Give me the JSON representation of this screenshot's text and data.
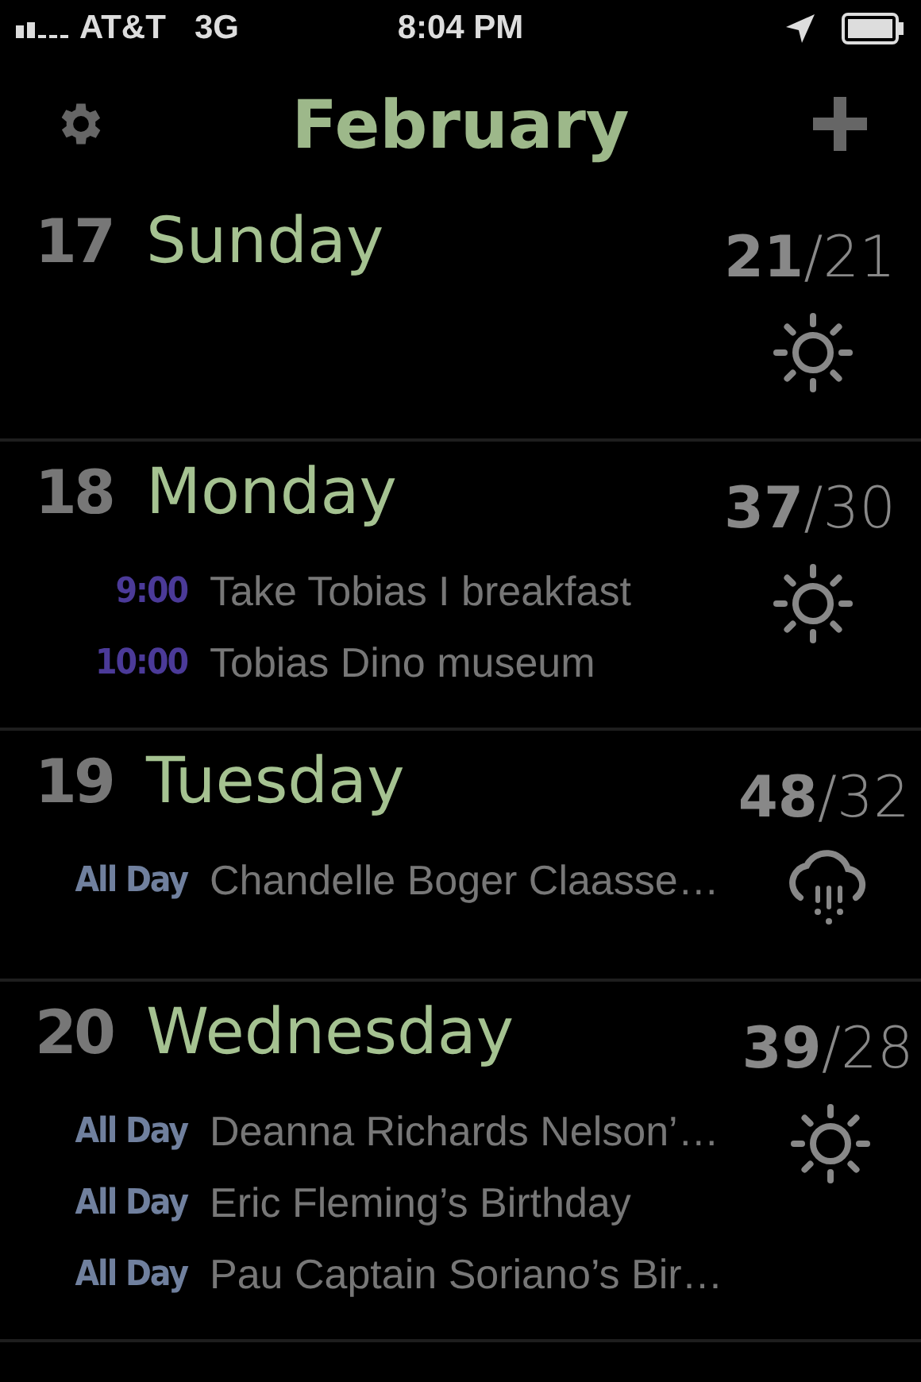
{
  "status_bar": {
    "carrier": "AT&T",
    "network": "3G",
    "time": "8:04 PM"
  },
  "header": {
    "title": "February"
  },
  "days": [
    {
      "number": "17",
      "name": "Sunday",
      "temperature": "**21**/21",
      "weather": {
        "kind": "sun"
      }
    },
    {
      "number": "18",
      "name": "Monday",
      "temperature": "**37**/30",
      "weather": {
        "kind": "sun"
      },
      "events": [
        {
          "kind": "timed",
          "time": "9:00",
          "title": "Take Tobias I breakfast"
        },
        {
          "kind": "timed",
          "time": "10:00",
          "title": "Tobias Dino museum"
        }
      ]
    },
    {
      "number": "19",
      "name": "Tuesday",
      "temperature": "**48**/32",
      "weather": {
        "kind": "rain"
      },
      "events": [
        {
          "kind": "allday",
          "time": "All Day",
          "title": "Chandelle Boger Claasse…"
        }
      ]
    },
    {
      "number": "20",
      "name": "Wednesday",
      "temperature": "**39**/28",
      "weather": {
        "kind": "sun"
      },
      "events": [
        {
          "kind": "allday",
          "time": "All Day",
          "title": "Deanna Richards Nelson’…"
        },
        {
          "kind": "allday",
          "time": "All Day",
          "title": "Eric Fleming’s Birthday"
        },
        {
          "kind": "allday",
          "time": "All Day",
          "title": "Pau Captain Soriano’s Bir…"
        }
      ]
    }
  ]
}
